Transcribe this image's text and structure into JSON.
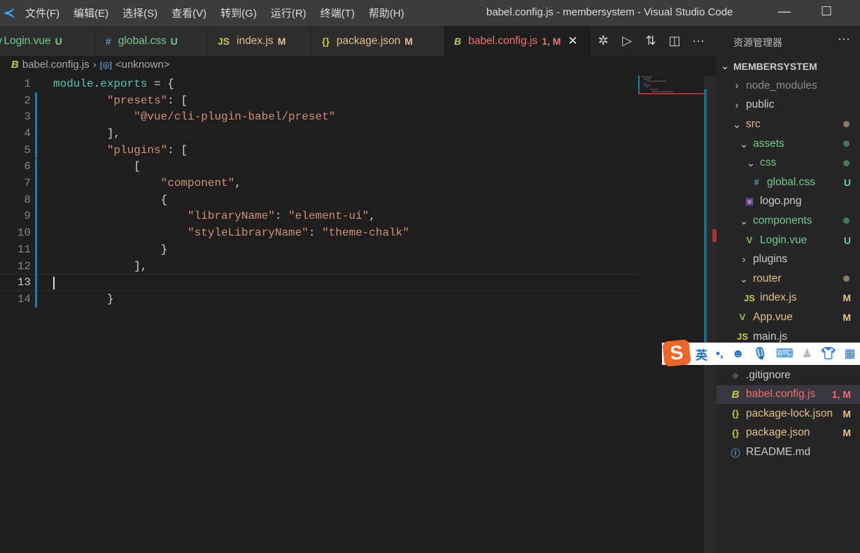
{
  "titlebar": {
    "menu": [
      "文件(F)",
      "编辑(E)",
      "选择(S)",
      "查看(V)",
      "转到(G)",
      "运行(R)",
      "终端(T)",
      "帮助(H)"
    ],
    "title": "babel.config.js - membersystem - Visual Studio Code"
  },
  "tabs": [
    {
      "icon": "V",
      "icon_name": "vue-icon",
      "label": "Login.vue",
      "status": "U",
      "color": "#73c991",
      "icon_color": "#41b883"
    },
    {
      "icon": "#",
      "icon_name": "css-hash-icon",
      "label": "global.css",
      "status": "U",
      "color": "#73c991",
      "icon_color": "#519aba"
    },
    {
      "icon": "JS",
      "icon_name": "js-icon",
      "label": "index.js",
      "status": "M",
      "color": "#e2c08d",
      "icon_color": "#cbcb41"
    },
    {
      "icon": "{}",
      "icon_name": "json-braces-icon",
      "label": "package.json",
      "status": "M",
      "color": "#e2c08d",
      "icon_color": "#cbcb41"
    },
    {
      "icon": "B",
      "icon_name": "babel-icon",
      "label": "babel.config.js",
      "status": "1, M",
      "color": "#f07070",
      "icon_color": "#cbcb41",
      "active": true
    }
  ],
  "breadcrumb": {
    "file": "babel.config.js",
    "symbol": "<unknown>"
  },
  "code": [
    [
      [
        "t-var",
        "module"
      ],
      [
        "t-p",
        "."
      ],
      [
        "t-var",
        "exports"
      ],
      [
        "t-p",
        " = {"
      ]
    ],
    [
      [
        "t-p",
        "        "
      ],
      [
        "t-str",
        "\"presets\""
      ],
      [
        "t-p",
        ": ["
      ]
    ],
    [
      [
        "t-p",
        "            "
      ],
      [
        "t-str",
        "\"@vue/cli-plugin-babel/preset\""
      ]
    ],
    [
      [
        "t-p",
        "        ],"
      ]
    ],
    [
      [
        "t-p",
        "        "
      ],
      [
        "t-str",
        "\"plugins\""
      ],
      [
        "t-p",
        ": ["
      ]
    ],
    [
      [
        "t-p",
        "            ["
      ]
    ],
    [
      [
        "t-p",
        "                "
      ],
      [
        "t-str",
        "\"component\""
      ],
      [
        "t-p",
        ","
      ]
    ],
    [
      [
        "t-p",
        "                {"
      ]
    ],
    [
      [
        "t-p",
        "                    "
      ],
      [
        "t-str",
        "\"libraryName\""
      ],
      [
        "t-p",
        ": "
      ],
      [
        "t-str",
        "\"element-ui\""
      ],
      [
        "t-p",
        ","
      ]
    ],
    [
      [
        "t-p",
        "                    "
      ],
      [
        "t-str",
        "\"styleLibraryName\""
      ],
      [
        "t-p",
        ": "
      ],
      [
        "t-str",
        "\"theme-chalk\""
      ]
    ],
    [
      [
        "t-p",
        "                }"
      ]
    ],
    [
      [
        "t-p",
        "            ],"
      ]
    ],
    [
      [
        "t-p",
        ""
      ]
    ],
    [
      [
        "t-p",
        "        }"
      ]
    ]
  ],
  "cursor_line": 13,
  "explorer": {
    "title": "资源管理器",
    "root": "MEMBERSYSTEM",
    "items": [
      {
        "label": "node_modules",
        "depth": 0,
        "kind": "closed",
        "color": "#8c8c8c"
      },
      {
        "label": "public",
        "depth": 0,
        "kind": "closed",
        "color": "#cccccc"
      },
      {
        "label": "src",
        "depth": 0,
        "kind": "open",
        "color": "#e2c08d",
        "dot": "#8b7a60"
      },
      {
        "label": "assets",
        "depth": 1,
        "kind": "open",
        "color": "#73c991",
        "dot": "#3f7a55"
      },
      {
        "label": "css",
        "depth": 2,
        "kind": "open",
        "color": "#73c991",
        "dot": "#3f7a55"
      },
      {
        "label": "global.css",
        "depth": 3,
        "kind": "file",
        "icon": "#",
        "icon_name": "css-hash-icon",
        "icon_color": "#519aba",
        "color": "#73c991",
        "status": "U"
      },
      {
        "label": "logo.png",
        "depth": 2,
        "kind": "file",
        "icon": "▣",
        "icon_name": "image-icon",
        "icon_color": "#a074c4",
        "color": "#cccccc"
      },
      {
        "label": "components",
        "depth": 1,
        "kind": "open",
        "color": "#73c991",
        "dot": "#3f7a55"
      },
      {
        "label": "Login.vue",
        "depth": 2,
        "kind": "file",
        "icon": "V",
        "icon_name": "vue-icon",
        "icon_color": "#8dc149",
        "color": "#73c991",
        "status": "U"
      },
      {
        "label": "plugins",
        "depth": 1,
        "kind": "closed",
        "color": "#cccccc"
      },
      {
        "label": "router",
        "depth": 1,
        "kind": "open",
        "color": "#e2c08d",
        "dot": "#8b7a60"
      },
      {
        "label": "index.js",
        "depth": 2,
        "kind": "file",
        "icon": "JS",
        "icon_name": "js-icon",
        "icon_color": "#cbcb41",
        "color": "#e2c08d",
        "status": "M"
      },
      {
        "label": "App.vue",
        "depth": 1,
        "kind": "file",
        "icon": "V",
        "icon_name": "vue-icon",
        "icon_color": "#8dc149",
        "color": "#e2c08d",
        "status": "M"
      },
      {
        "label": "main.js",
        "depth": 1,
        "kind": "file",
        "icon": "JS",
        "icon_name": "js-icon",
        "icon_color": "#cbcb41",
        "color": "#cccccc"
      },
      {
        "label": "",
        "depth": 0,
        "kind": "hidden"
      },
      {
        "label": ".gitignore",
        "depth": 0,
        "kind": "file",
        "icon": "◆",
        "icon_name": "git-icon",
        "icon_color": "#41535b",
        "color": "#cccccc"
      },
      {
        "label": "babel.config.js",
        "depth": 0,
        "kind": "file",
        "icon": "B",
        "icon_name": "babel-icon",
        "icon_color": "#cbcb41",
        "color": "#f07070",
        "status": "1, M",
        "selected": true
      },
      {
        "label": "package-lock.json",
        "depth": 0,
        "kind": "file",
        "icon": "{}",
        "icon_name": "json-braces-icon",
        "icon_color": "#cbcb41",
        "color": "#e2c08d",
        "status": "M"
      },
      {
        "label": "package.json",
        "depth": 0,
        "kind": "file",
        "icon": "{}",
        "icon_name": "json-braces-icon",
        "icon_color": "#cbcb41",
        "color": "#e2c08d",
        "status": "M"
      },
      {
        "label": "README.md",
        "depth": 0,
        "kind": "file",
        "icon": "ⓘ",
        "icon_name": "info-icon",
        "icon_color": "#519aba",
        "color": "#cccccc"
      }
    ]
  },
  "ime": {
    "lang": "英",
    "punct": "•,"
  }
}
